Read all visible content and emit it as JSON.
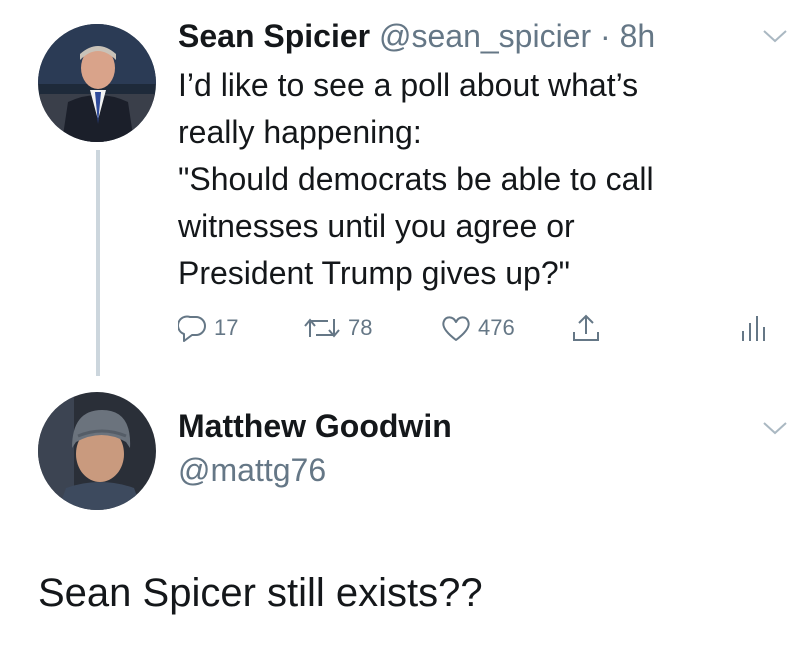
{
  "tweet1": {
    "display_name": "Sean Spicier",
    "handle_time": "@sean_spicier · 8h",
    "text_lines": [
      "I’d like to see a poll about what’s",
      "really happening:",
      "\"Should democrats be able to call",
      "witnesses until you agree or",
      "President Trump gives up?\""
    ],
    "replies": "17",
    "retweets": "78",
    "likes": "476"
  },
  "tweet2": {
    "display_name": "Matthew Goodwin",
    "handle": "@mattg76",
    "text": "Sean Spicer still exists??"
  },
  "colors": {
    "text": "#14171a",
    "secondary": "#657786",
    "thread_line": "#ccd6dd"
  },
  "icons": [
    "chevron-down-icon",
    "reply-icon",
    "retweet-icon",
    "like-icon",
    "share-icon",
    "analytics-icon"
  ]
}
